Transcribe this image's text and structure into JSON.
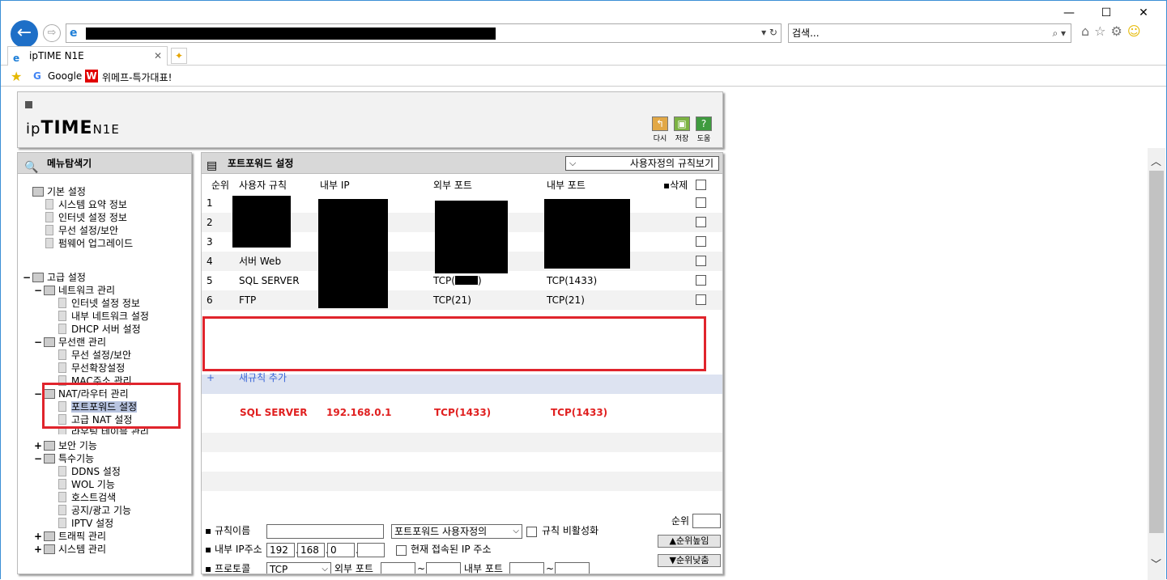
{
  "browser": {
    "window_controls": [
      "—",
      "☐",
      "✕"
    ],
    "search_placeholder": "검색...",
    "tab_title": "ipTIME N1E",
    "favorites": [
      "Google",
      "위메프-특가대표!"
    ]
  },
  "router": {
    "logo": {
      "ip": "ip",
      "time": "TIME",
      "model": "N1E"
    },
    "header_buttons": [
      "다시",
      "저장",
      "도움"
    ]
  },
  "menu": {
    "title": "메뉴탐색기",
    "basic": "기본 설정",
    "basic_items": [
      "시스템 요약 정보",
      "인터넷 설정 정보",
      "무선 설정/보안",
      "펌웨어 업그레이드"
    ],
    "advanced": "고급 설정",
    "network": "네트워크 관리",
    "network_items": [
      "인터넷 설정 정보",
      "내부 네트워크 설정",
      "DHCP 서버 설정"
    ],
    "wireless": "무선랜 관리",
    "wireless_items": [
      "무선 설정/보안",
      "무선확장설정",
      "MAC주소 관리"
    ],
    "nat": "NAT/라우터 관리",
    "nat_items": [
      "포트포워드 설정",
      "고급 NAT 설정",
      "라우팅 테이블 관리"
    ],
    "security": "보안 기능",
    "special": "특수기능",
    "special_items": [
      "DDNS 설정",
      "WOL 기능",
      "호스트검색",
      "공지/광고 기능",
      "IPTV 설정"
    ],
    "traffic": "트래픽 관리",
    "system": "시스템 관리"
  },
  "main": {
    "title": "포트포워드 설정",
    "view_select": "사용자정의 규칙보기",
    "columns": [
      "순위",
      "사용자 규칙",
      "내부 IP",
      "외부 포트",
      "내부 포트",
      "삭제"
    ],
    "rows": [
      {
        "no": "1",
        "rule": "",
        "ip": "",
        "ext": "",
        "int": ""
      },
      {
        "no": "2",
        "rule": "",
        "ip": "",
        "ext": "",
        "int": ""
      },
      {
        "no": "3",
        "rule": "",
        "ip": "",
        "ext": "",
        "int": ""
      },
      {
        "no": "4",
        "rule": "서버 Web",
        "ip": "",
        "ext": "",
        "int": ""
      },
      {
        "no": "5",
        "rule": "SQL SERVER",
        "ip": "",
        "ext": "TCP(",
        "ext_end": ")",
        "int": "TCP(1433)"
      },
      {
        "no": "6",
        "rule": "FTP",
        "ip": "",
        "ext": "TCP(21)",
        "int": "TCP(21)"
      }
    ],
    "add_rule": "새규칙 추가",
    "new_rule": {
      "name": "SQL SERVER",
      "ip": "192.168.0.1",
      "ext": "TCP(1433)",
      "int": "TCP(1433)"
    }
  },
  "form": {
    "rule_name_label": "규칙이름",
    "rule_type": "포트포워드 사용자정의",
    "disable_label": "규칙 비활성화",
    "rank_label": "순위",
    "rank_up": "▲순위높임",
    "rank_down": "▼순위낮춤",
    "ip_label": "내부 IP주소",
    "ip": [
      "192",
      "168",
      "0",
      ""
    ],
    "current_ip_label": "현재 접속된 IP 주소",
    "protocol_label": "프로토콜",
    "protocol": "TCP",
    "ext_port_label": "외부 포트",
    "int_port_label": "내부 포트",
    "tilde": "~"
  }
}
